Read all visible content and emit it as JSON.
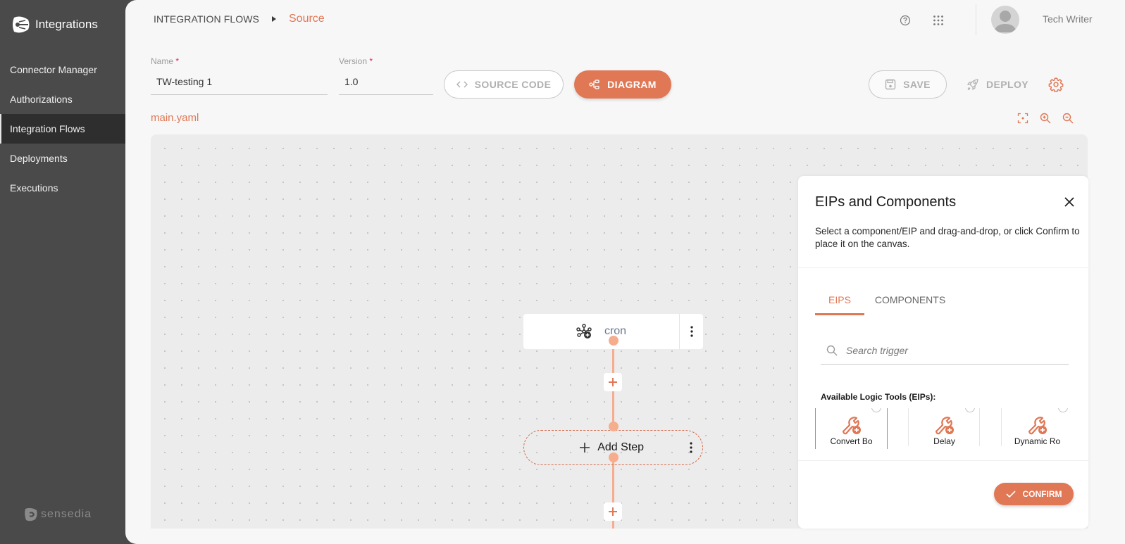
{
  "app": {
    "name": "Integrations",
    "footer_brand": "sensedia"
  },
  "sidebar": {
    "items": [
      {
        "label": "Connector Manager",
        "active": false
      },
      {
        "label": "Authorizations",
        "active": false
      },
      {
        "label": "Integration Flows",
        "active": true
      },
      {
        "label": "Deployments",
        "active": false
      },
      {
        "label": "Executions",
        "active": false
      }
    ]
  },
  "header": {
    "breadcrumb_root": "INTEGRATION FLOWS",
    "breadcrumb_current": "Source",
    "user_name": "Tech Writer",
    "icons": [
      "help-icon",
      "apps-grid-icon",
      "avatar"
    ]
  },
  "form": {
    "name_label": "Name",
    "name_value": "TW-testing 1",
    "version_label": "Version",
    "version_value": "1.0",
    "required_mark": "*"
  },
  "toolbar": {
    "source_code_label": "SOURCE CODE",
    "diagram_label": "DIAGRAM",
    "save_label": "SAVE",
    "deploy_label": "DEPLOY"
  },
  "editor": {
    "filename": "main.yaml",
    "canvas_tools": [
      "fit-view-icon",
      "zoom-in-icon",
      "zoom-out-icon"
    ]
  },
  "canvas": {
    "nodes": [
      {
        "type": "trigger",
        "label": "cron",
        "icon": "cron-trigger-icon"
      },
      {
        "type": "placeholder",
        "label": "Add Step"
      }
    ]
  },
  "panel": {
    "title": "EIPs and Components",
    "description": "Select a component/EIP and drag-and-drop, or click Confirm to place it on the canvas.",
    "tabs": [
      {
        "label": "EIPS",
        "active": true
      },
      {
        "label": "COMPONENTS",
        "active": false
      }
    ],
    "search_placeholder": "Search trigger",
    "available_label": "Available Logic Tools (EIPs):",
    "tools": [
      {
        "label": "Convert Bo",
        "selected": true
      },
      {
        "label": "Delay",
        "selected": false
      },
      {
        "label": "Dynamic Ro",
        "selected": false
      }
    ],
    "confirm_label": "CONFIRM"
  },
  "colors": {
    "accent": "#e07755",
    "connector": "#f6ad8e",
    "sidebar_bg": "#4a4a4a",
    "sidebar_active": "#2e2e2e"
  }
}
